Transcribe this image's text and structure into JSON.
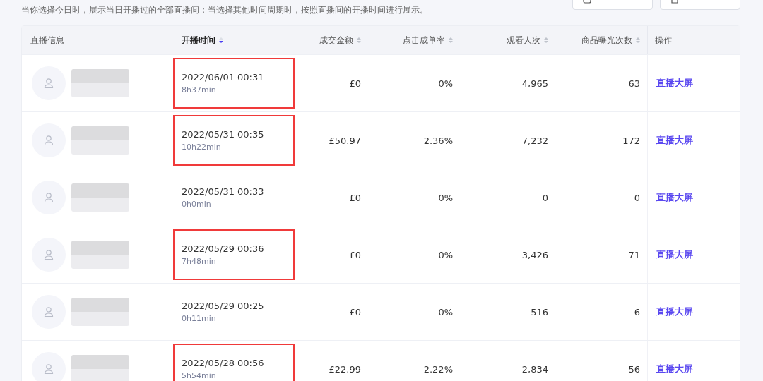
{
  "notice": "当你选择今日时，展示当日开播过的全部直播间；当选择其他时间周期时，按照直播间的开播时间进行展示。",
  "toolbar_buttons": [
    {
      "kind": "settings"
    },
    {
      "kind": "export"
    }
  ],
  "table": {
    "columns": [
      {
        "label": "直播信息",
        "sortable": false,
        "sorted": false
      },
      {
        "label": "开播时间",
        "sortable": true,
        "sorted": true
      },
      {
        "label": "成交金额",
        "sortable": true,
        "sorted": false
      },
      {
        "label": "点击成单率",
        "sortable": true,
        "sorted": false
      },
      {
        "label": "观看人次",
        "sortable": true,
        "sorted": false
      },
      {
        "label": "商品曝光次数",
        "sortable": true,
        "sorted": false
      },
      {
        "label": "操作",
        "sortable": false,
        "sorted": false
      }
    ],
    "rows": [
      {
        "start": "2022/06/01 00:31",
        "duration": "8h37min",
        "amount": "£0",
        "ctr": "0%",
        "views": "4,965",
        "exposure": "63",
        "action": "直播大屏",
        "highlighted": true
      },
      {
        "start": "2022/05/31 00:35",
        "duration": "10h22min",
        "amount": "£50.97",
        "ctr": "2.36%",
        "views": "7,232",
        "exposure": "172",
        "action": "直播大屏",
        "highlighted": true
      },
      {
        "start": "2022/05/31 00:33",
        "duration": "0h0min",
        "amount": "£0",
        "ctr": "0%",
        "views": "0",
        "exposure": "0",
        "action": "直播大屏",
        "highlighted": false
      },
      {
        "start": "2022/05/29 00:36",
        "duration": "7h48min",
        "amount": "£0",
        "ctr": "0%",
        "views": "3,426",
        "exposure": "71",
        "action": "直播大屏",
        "highlighted": true
      },
      {
        "start": "2022/05/29 00:25",
        "duration": "0h11min",
        "amount": "£0",
        "ctr": "0%",
        "views": "516",
        "exposure": "6",
        "action": "直播大屏",
        "highlighted": false
      },
      {
        "start": "2022/05/28 00:56",
        "duration": "5h54min",
        "amount": "£22.99",
        "ctr": "2.22%",
        "views": "2,834",
        "exposure": "56",
        "action": "直播大屏",
        "highlighted": true
      }
    ]
  }
}
